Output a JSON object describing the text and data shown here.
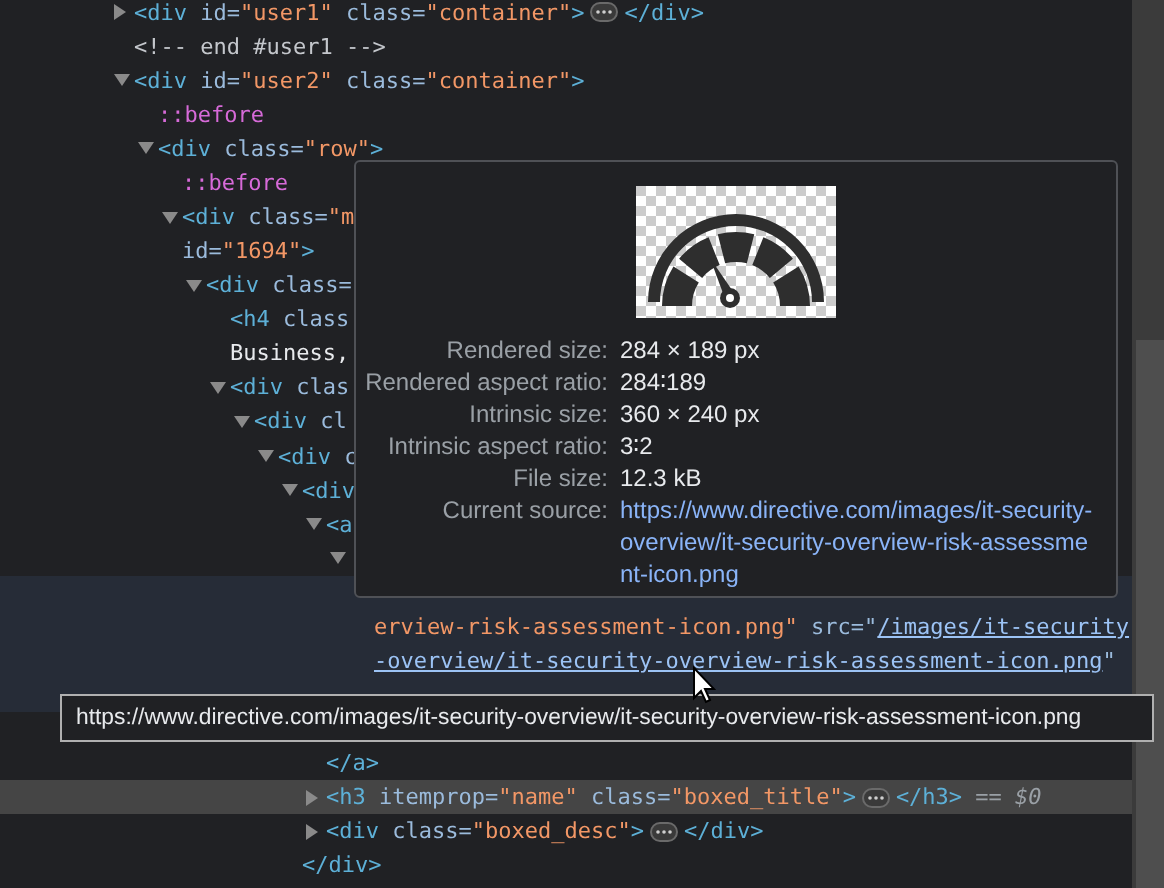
{
  "elements_tree": [
    {
      "lines": [
        [
          {
            "kind": "tag",
            "text": "<div"
          },
          {
            "kind": "attr",
            "text": " id="
          },
          {
            "kind": "value",
            "text": "\"user1\""
          },
          {
            "kind": "attr",
            "text": " class="
          },
          {
            "kind": "value",
            "text": "\"container\""
          },
          {
            "kind": "tag",
            "text": ">"
          },
          {
            "kind": "ellipsis"
          },
          {
            "kind": "tag",
            "text": "</div>"
          }
        ]
      ],
      "expanded": false,
      "selected": false,
      "hovered": false
    },
    {
      "lines": [
        [
          {
            "kind": "comment",
            "text": "<!-- end #user1 -->"
          }
        ]
      ],
      "selected": false,
      "hovered": false
    },
    {
      "lines": [
        [
          {
            "kind": "tag",
            "text": "<div"
          },
          {
            "kind": "attr",
            "text": " id="
          },
          {
            "kind": "value",
            "text": "\"user2\""
          },
          {
            "kind": "attr",
            "text": " class="
          },
          {
            "kind": "value",
            "text": "\"container\""
          },
          {
            "kind": "tag",
            "text": ">"
          }
        ]
      ],
      "expanded": true,
      "selected": false,
      "hovered": false,
      "children": [
        {
          "lines": [
            [
              {
                "kind": "pseudo",
                "text": "::before"
              }
            ]
          ],
          "selected": false,
          "hovered": false
        },
        {
          "lines": [
            [
              {
                "kind": "tag",
                "text": "<div"
              },
              {
                "kind": "attr",
                "text": " class="
              },
              {
                "kind": "value",
                "text": "\"row\""
              },
              {
                "kind": "tag",
                "text": ">"
              }
            ]
          ],
          "expanded": true,
          "selected": false,
          "hovered": false,
          "children": [
            {
              "lines": [
                [
                  {
                    "kind": "pseudo",
                    "text": "::before"
                  }
                ]
              ],
              "selected": false,
              "hovered": false
            },
            {
              "lines": [
                [
                  {
                    "kind": "tag",
                    "text": "<div"
                  },
                  {
                    "kind": "attr",
                    "text": " class="
                  },
                  {
                    "kind": "value",
                    "text": "\"m"
                  }
                ],
                [
                  {
                    "kind": "attr",
                    "text": "id="
                  },
                  {
                    "kind": "value",
                    "text": "\"1694\""
                  },
                  {
                    "kind": "tag",
                    "text": ">"
                  }
                ]
              ],
              "expanded": true,
              "selected": false,
              "hovered": false,
              "children": [
                {
                  "lines": [
                    [
                      {
                        "kind": "tag",
                        "text": "<div"
                      },
                      {
                        "kind": "attr",
                        "text": " class="
                      }
                    ]
                  ],
                  "expanded": true,
                  "selected": false,
                  "hovered": false,
                  "children": [
                    {
                      "lines": [
                        [
                          {
                            "kind": "tag",
                            "text": "<h4"
                          },
                          {
                            "kind": "attr",
                            "text": " class"
                          }
                        ],
                        [
                          {
                            "kind": "text",
                            "text": "Business,"
                          }
                        ]
                      ],
                      "selected": false,
                      "hovered": false
                    },
                    {
                      "lines": [
                        [
                          {
                            "kind": "tag",
                            "text": "<div"
                          },
                          {
                            "kind": "attr",
                            "text": " clas"
                          }
                        ]
                      ],
                      "expanded": true,
                      "selected": false,
                      "hovered": false,
                      "children": [
                        {
                          "lines": [
                            [
                              {
                                "kind": "tag",
                                "text": "<div"
                              },
                              {
                                "kind": "attr",
                                "text": " cl"
                              }
                            ]
                          ],
                          "expanded": true,
                          "selected": false,
                          "hovered": false,
                          "children": [
                            {
                              "lines": [
                                [
                                  {
                                    "kind": "tag",
                                    "text": "<div"
                                  },
                                  {
                                    "kind": "attr",
                                    "text": " c"
                                  }
                                ]
                              ],
                              "expanded": true,
                              "selected": false,
                              "hovered": false,
                              "children": [
                                {
                                  "lines": [
                                    [
                                      {
                                        "kind": "tag",
                                        "text": "<div"
                                      }
                                    ]
                                  ],
                                  "expanded": true,
                                  "selected": false,
                                  "hovered": false,
                                  "closing": [
                                    {
                                      "kind": "tag",
                                      "text": "</div>"
                                    }
                                  ],
                                  "children": [
                                    {
                                      "lines": [
                                        [
                                          {
                                            "kind": "tag",
                                            "text": "<a"
                                          }
                                        ]
                                      ],
                                      "expanded": true,
                                      "selected": false,
                                      "hovered": false,
                                      "closing": [
                                        {
                                          "kind": "tag",
                                          "text": "</a>"
                                        }
                                      ],
                                      "children": [
                                        {
                                          "expanded": true,
                                          "selected": false,
                                          "hovered": false,
                                          "children": [
                                            {
                                              "lines": [
                                                {
                                                  "kind": "covered"
                                                },
                                                [
                                                  {
                                                    "kind": "value",
                                                    "text": "erview-risk-assessment-icon.png\""
                                                  },
                                                  {
                                                    "kind": "attr",
                                                    "text": " src=\""
                                                  },
                                                  {
                                                    "kind": "link",
                                                    "text": "/images/it-security"
                                                  }
                                                ],
                                                [
                                                  {
                                                    "kind": "link",
                                                    "text": "-overview/it-security-overview-risk-assessment-icon.png"
                                                  },
                                                  {
                                                    "kind": "attr",
                                                    "text": "\""
                                                  }
                                                ],
                                                {
                                                  "kind": "covered"
                                                }
                                              ],
                                              "selected": false,
                                              "hovered": true
                                            }
                                          ]
                                        }
                                      ]
                                    },
                                    {
                                      "lines": [
                                        [
                                          {
                                            "kind": "tag",
                                            "text": "<h3"
                                          },
                                          {
                                            "kind": "attr",
                                            "text": " itemprop="
                                          },
                                          {
                                            "kind": "value",
                                            "text": "\"name\""
                                          },
                                          {
                                            "kind": "attr",
                                            "text": " class="
                                          },
                                          {
                                            "kind": "value",
                                            "text": "\"boxed_title\""
                                          },
                                          {
                                            "kind": "tag",
                                            "text": ">"
                                          },
                                          {
                                            "kind": "ellipsis"
                                          },
                                          {
                                            "kind": "tag",
                                            "text": "</h3>"
                                          },
                                          {
                                            "kind": "marker",
                                            "text": " == $0"
                                          }
                                        ]
                                      ],
                                      "expanded": false,
                                      "selected": true,
                                      "hovered": false
                                    },
                                    {
                                      "lines": [
                                        [
                                          {
                                            "kind": "tag",
                                            "text": "<div"
                                          },
                                          {
                                            "kind": "attr",
                                            "text": " class="
                                          },
                                          {
                                            "kind": "value",
                                            "text": "\"boxed_desc\""
                                          },
                                          {
                                            "kind": "tag",
                                            "text": ">"
                                          },
                                          {
                                            "kind": "ellipsis"
                                          },
                                          {
                                            "kind": "tag",
                                            "text": "</div>"
                                          }
                                        ]
                                      ],
                                      "expanded": false,
                                      "selected": false,
                                      "hovered": false
                                    }
                                  ]
                                }
                              ]
                            }
                          ]
                        }
                      ]
                    }
                  ]
                }
              ]
            }
          ]
        }
      ]
    }
  ],
  "image_tooltip": {
    "rows": [
      {
        "label": "Rendered size:",
        "value": "284 × 189 px"
      },
      {
        "label": "Rendered aspect ratio:",
        "value": "284∶189"
      },
      {
        "label": "Intrinsic size:",
        "value": "360 × 240 px"
      },
      {
        "label": "Intrinsic aspect ratio:",
        "value": "3∶2"
      },
      {
        "label": "File size:",
        "value": "12.3 kB"
      }
    ],
    "source": {
      "label": "Current source:",
      "url": "https://www.directive.com/images/it-security-overview/it-security-overview-risk-assessment-icon.png"
    }
  },
  "link_tooltip": {
    "text": "https://www.directive.com/images/it-security-overview/it-security-overview-risk-assessment-icon.png"
  }
}
